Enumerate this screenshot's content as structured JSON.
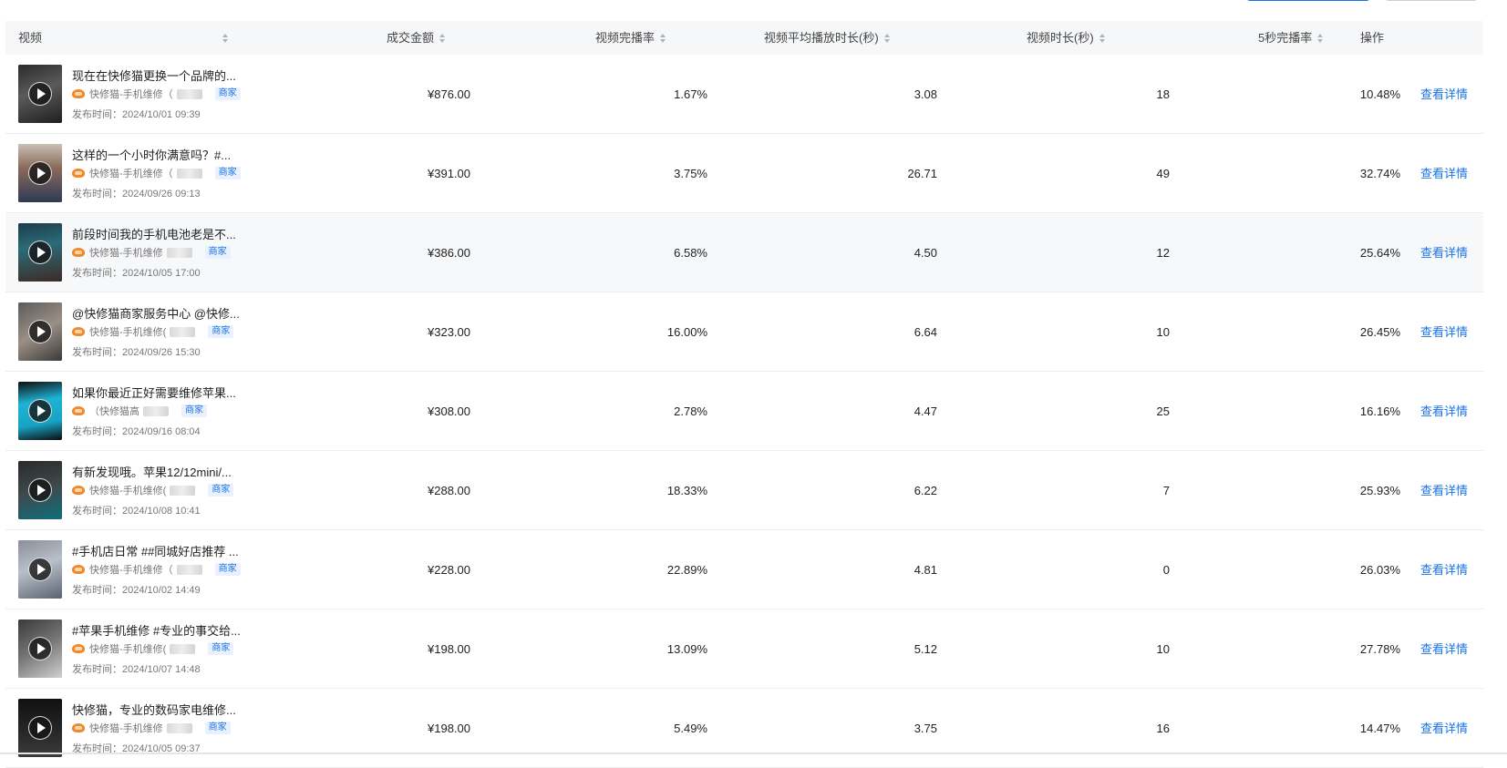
{
  "headers": {
    "video": "视频",
    "amount": "成交金额",
    "completion_rate": "视频完播率",
    "avg_play": "视频平均播放时长(秒)",
    "duration": "视频时长(秒)",
    "five_sec_rate": "5秒完播率",
    "action": "操作"
  },
  "badge_label": "商家",
  "action_label": "查看详情",
  "rows": [
    {
      "title": "现在在快修猫更换一个品牌的...",
      "author": "快修猫-手机维修（",
      "time": "发布时间：2024/10/01 09:39",
      "amount": "¥876.00",
      "completion_rate": "1.67%",
      "avg_play": "3.08",
      "duration": "18",
      "five_sec_rate": "10.48%"
    },
    {
      "title": "这样的一个小时你满意吗？#...",
      "author": "快修猫-手机维修（",
      "time": "发布时间：2024/09/26 09:13",
      "amount": "¥391.00",
      "completion_rate": "3.75%",
      "avg_play": "26.71",
      "duration": "49",
      "five_sec_rate": "32.74%"
    },
    {
      "title": "前段时间我的手机电池老是不...",
      "author": "快修猫-手机维修",
      "time": "发布时间：2024/10/05 17:00",
      "amount": "¥386.00",
      "completion_rate": "6.58%",
      "avg_play": "4.50",
      "duration": "12",
      "five_sec_rate": "25.64%"
    },
    {
      "title": "@快修猫商家服务中心 @快修...",
      "author": "快修猫-手机维修(",
      "time": "发布时间：2024/09/26 15:30",
      "amount": "¥323.00",
      "completion_rate": "16.00%",
      "avg_play": "6.64",
      "duration": "10",
      "five_sec_rate": "26.45%"
    },
    {
      "title": "如果你最近正好需要维修苹果...",
      "author": "（快修猫高",
      "time": "发布时间：2024/09/16 08:04",
      "amount": "¥308.00",
      "completion_rate": "2.78%",
      "avg_play": "4.47",
      "duration": "25",
      "five_sec_rate": "16.16%"
    },
    {
      "title": "有新发现哦。苹果12/12mini/...",
      "author": "快修猫-手机维修(",
      "time": "发布时间：2024/10/08 10:41",
      "amount": "¥288.00",
      "completion_rate": "18.33%",
      "avg_play": "6.22",
      "duration": "7",
      "five_sec_rate": "25.93%"
    },
    {
      "title": "#手机店日常 ##同城好店推荐 ...",
      "author": "快修猫-手机维修（",
      "time": "发布时间：2024/10/02 14:49",
      "amount": "¥228.00",
      "completion_rate": "22.89%",
      "avg_play": "4.81",
      "duration": "0",
      "five_sec_rate": "26.03%"
    },
    {
      "title": "#苹果手机维修 #专业的事交给...",
      "author": "快修猫-手机维修(",
      "time": "发布时间：2024/10/07 14:48",
      "amount": "¥198.00",
      "completion_rate": "13.09%",
      "avg_play": "5.12",
      "duration": "10",
      "five_sec_rate": "27.78%"
    },
    {
      "title": "快修猫，专业的数码家电维修...",
      "author": "快修猫-手机维修",
      "time": "发布时间：2024/10/05 09:37",
      "amount": "¥198.00",
      "completion_rate": "5.49%",
      "avg_play": "3.75",
      "duration": "16",
      "five_sec_rate": "14.47%"
    }
  ],
  "colors": {
    "link": "#1a73e8",
    "header_bg": "#f6f7f9",
    "hover_row_bg": "#f7f8fa",
    "avatar": "#f0892b"
  }
}
